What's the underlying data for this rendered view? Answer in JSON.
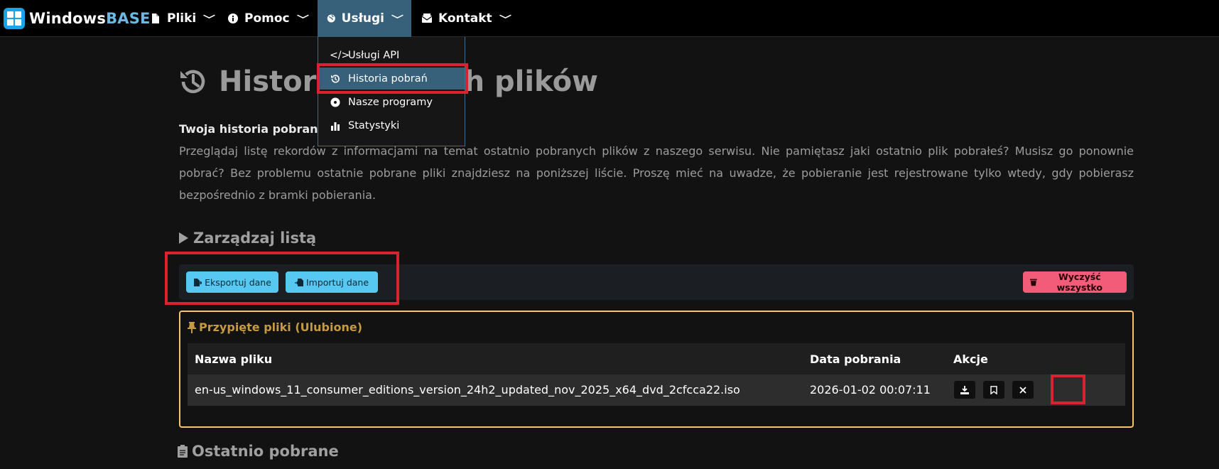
{
  "brand": {
    "name_main": "Windows",
    "name_accent": "BASE"
  },
  "nav": {
    "items": [
      {
        "label": "Pliki",
        "icon": "file-icon"
      },
      {
        "label": "Pomoc",
        "icon": "info-icon"
      },
      {
        "label": "Usługi",
        "icon": "globe-icon"
      },
      {
        "label": "Kontakt",
        "icon": "envelope-icon"
      }
    ]
  },
  "dropdown": {
    "items": [
      {
        "label": "Usługi API",
        "icon": "code-icon"
      },
      {
        "label": "Historia pobrań",
        "icon": "history-icon"
      },
      {
        "label": "Nasze programy",
        "icon": "disc-icon"
      },
      {
        "label": "Statystyki",
        "icon": "bar-chart-icon"
      }
    ]
  },
  "page": {
    "title_start": "Historia",
    "title_end": "h plików",
    "intro_bold": "Twoja historia pobranyc",
    "intro_text": "Przeglądaj listę rekordów z informacjami na temat ostatnio pobranych plików z naszego serwisu. Nie pamiętasz jaki ostatnio plik pobrałeś? Musisz go ponownie pobrać? Bez problemu ostatnie pobrane pliki znajdziesz na poniższej liście. Proszę mieć na uwadze, że pobieranie jest rejestrowane tylko wtedy, gdy pobierasz bezpośrednio z bramki pobierania."
  },
  "manage": {
    "title": "Zarządzaj listą",
    "export_label": "Eksportuj dane",
    "import_label": "Importuj dane",
    "clear_label": "Wyczyść wszystko"
  },
  "pinned": {
    "title": "Przypięte pliki (Ulubione)",
    "columns": [
      "Nazwa pliku",
      "Data pobrania",
      "Akcje"
    ],
    "rows": [
      {
        "name": "en-us_windows_11_consumer_editions_version_24h2_updated_nov_2025_x64_dvd_2cfcca22.iso",
        "date": "2026-01-02 00:07:11"
      }
    ]
  },
  "recent": {
    "title": "Ostatnio pobrane"
  },
  "colors": {
    "accent": "#37607a",
    "info": "#56c8f2",
    "danger": "#f25c78",
    "pinned_border": "#f5c56d",
    "highlight": "#d9232f"
  }
}
